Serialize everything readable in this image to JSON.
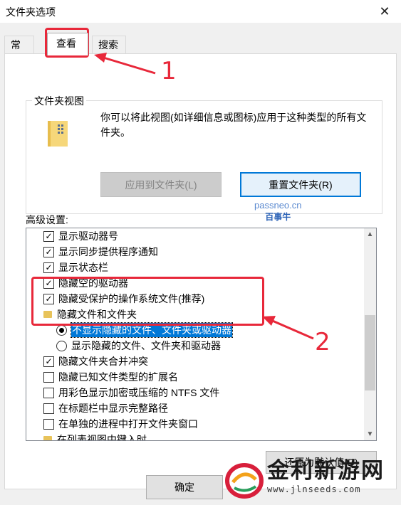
{
  "window": {
    "title": "文件夹选项",
    "close_glyph": "✕"
  },
  "tabs": [
    {
      "label": "常规"
    },
    {
      "label": "查看"
    },
    {
      "label": "搜索"
    }
  ],
  "folder_views": {
    "group_title": "文件夹视图",
    "description": "你可以将此视图(如详细信息或图标)应用于这种类型的所有文件夹。",
    "apply_button": "应用到文件夹(L)",
    "reset_button": "重置文件夹(R)"
  },
  "advanced": {
    "label": "高级设置:",
    "items": [
      {
        "type": "checkbox",
        "checked": true,
        "label": "显示驱动器号"
      },
      {
        "type": "checkbox",
        "checked": true,
        "label": "显示同步提供程序通知"
      },
      {
        "type": "checkbox",
        "checked": true,
        "label": "显示状态栏"
      },
      {
        "type": "checkbox",
        "checked": true,
        "label": "隐藏空的驱动器"
      },
      {
        "type": "checkbox",
        "checked": true,
        "label": "隐藏受保护的操作系统文件(推荐)"
      },
      {
        "type": "folder",
        "label": "隐藏文件和文件夹"
      },
      {
        "type": "radio",
        "selected": true,
        "label": "不显示隐藏的文件、文件夹或驱动器"
      },
      {
        "type": "radio",
        "selected": false,
        "label": "显示隐藏的文件、文件夹和驱动器"
      },
      {
        "type": "checkbox",
        "checked": true,
        "label": "隐藏文件夹合并冲突"
      },
      {
        "type": "checkbox",
        "checked": false,
        "label": "隐藏已知文件类型的扩展名"
      },
      {
        "type": "checkbox",
        "checked": false,
        "label": "用彩色显示加密或压缩的 NTFS 文件"
      },
      {
        "type": "checkbox",
        "checked": false,
        "label": "在标题栏中显示完整路径"
      },
      {
        "type": "checkbox",
        "checked": false,
        "label": "在单独的进程中打开文件夹窗口"
      },
      {
        "type": "folder",
        "label": "在列表视图中键入时"
      }
    ],
    "restore_defaults": "还原为默认值(D)"
  },
  "footer": {
    "ok_button": "确定"
  },
  "annotations": {
    "marker_1": "1",
    "marker_2": "2"
  },
  "watermark": {
    "latin": "passneo.cn",
    "cn": "百事牛"
  },
  "logo": {
    "name": "金利新游网",
    "url": "www.jlnseeds.com"
  },
  "colors": {
    "annotation_red": "#e8283a",
    "selection_blue": "#0078d7"
  }
}
